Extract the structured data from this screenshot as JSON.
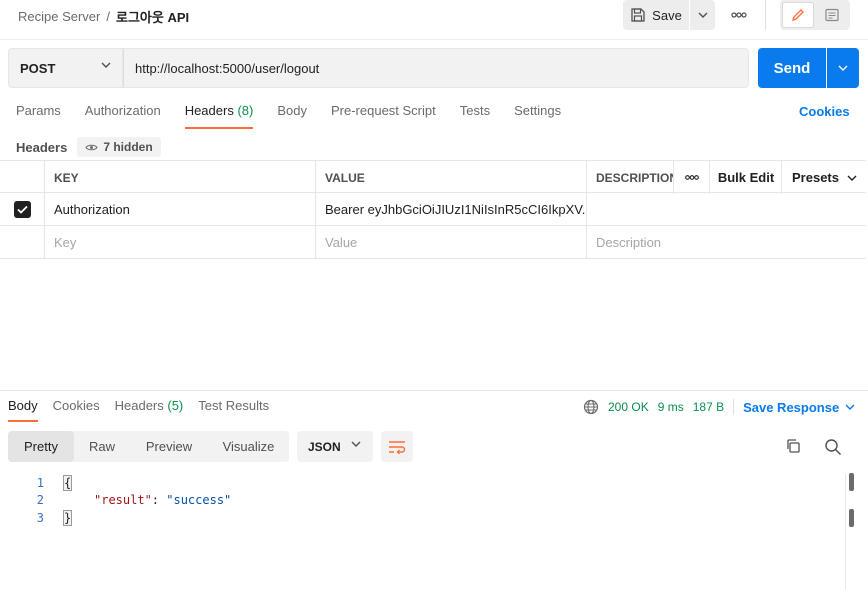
{
  "breadcrumb": {
    "collection": "Recipe Server",
    "separator": "/",
    "request": "로그아웃 API"
  },
  "toolbar": {
    "save_label": "Save"
  },
  "request": {
    "method": "POST",
    "url": "http://localhost:5000/user/logout",
    "send_label": "Send"
  },
  "req_tabs": [
    {
      "label": "Params",
      "count": ""
    },
    {
      "label": "Authorization",
      "count": ""
    },
    {
      "label": "Headers",
      "count": "(8)"
    },
    {
      "label": "Body",
      "count": ""
    },
    {
      "label": "Pre-request Script",
      "count": ""
    },
    {
      "label": "Tests",
      "count": ""
    },
    {
      "label": "Settings",
      "count": ""
    }
  ],
  "cookies_label": "Cookies",
  "headers_section": {
    "label": "Headers",
    "hidden_label": "7 hidden"
  },
  "table": {
    "columns": {
      "key": "KEY",
      "value": "VALUE",
      "description": "DESCRIPTION",
      "bulk_edit": "Bulk Edit",
      "presets": "Presets"
    },
    "rows": [
      {
        "key": "Authorization",
        "value": "Bearer eyJhbGciOiJIUzI1NiIsInR5cCI6IkpXV...",
        "description": "",
        "checked": true
      }
    ],
    "placeholders": {
      "key": "Key",
      "value": "Value",
      "description": "Description"
    }
  },
  "response": {
    "tabs": [
      {
        "label": "Body",
        "count": ""
      },
      {
        "label": "Cookies",
        "count": ""
      },
      {
        "label": "Headers",
        "count": "(5)"
      },
      {
        "label": "Test Results",
        "count": ""
      }
    ],
    "status": "200 OK",
    "time": "9 ms",
    "size": "187 B",
    "save_label": "Save Response",
    "views": [
      "Pretty",
      "Raw",
      "Preview",
      "Visualize"
    ],
    "format": "JSON",
    "lines": [
      {
        "n": "1",
        "open": "{"
      },
      {
        "n": "2",
        "key": "\"result\"",
        "colon": ": ",
        "value": "\"success\""
      },
      {
        "n": "3",
        "close": "}"
      }
    ]
  },
  "colors": {
    "accent": "#097bed",
    "active_tab": "#ff6c37",
    "count": "#0c8f4f"
  }
}
